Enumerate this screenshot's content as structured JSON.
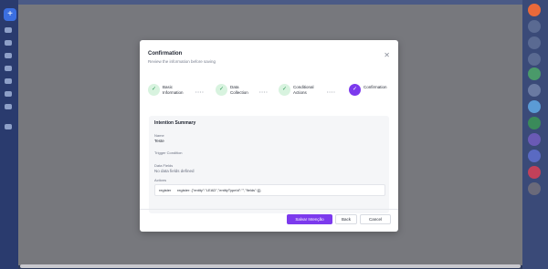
{
  "modal": {
    "title": "Confirmation",
    "subtitle": "Review the information before saving",
    "steps": [
      {
        "label": "Basic\nInformation",
        "state": "done"
      },
      {
        "label": "Data\nCollection",
        "state": "done"
      },
      {
        "label": "Conditional\nActions",
        "state": "done"
      },
      {
        "label": "Confirmation",
        "state": "active"
      }
    ],
    "step_separator": "••••",
    "summary": {
      "title": "Intention Summary",
      "name_label": "Name",
      "name_value": "Teste",
      "trigger_label": "Trigger Condition",
      "data_fields_label": "Data Fields",
      "data_fields_value": "No data fields defined",
      "actions_label": "Actions",
      "action_tag": "register",
      "action_text": "register: {\"entity\":\"LEAD\",\"entityTypeId\":\"\",\"fields\":{}}"
    },
    "buttons": {
      "save": "Salvar Intenção",
      "back": "Back",
      "cancel": "Cancel"
    }
  },
  "colors": {
    "accent": "#7c3aed",
    "done_step_bg": "#d8f3df",
    "overlay": "#77787d"
  },
  "icons": {
    "close": "close-icon",
    "check": "check-icon"
  }
}
